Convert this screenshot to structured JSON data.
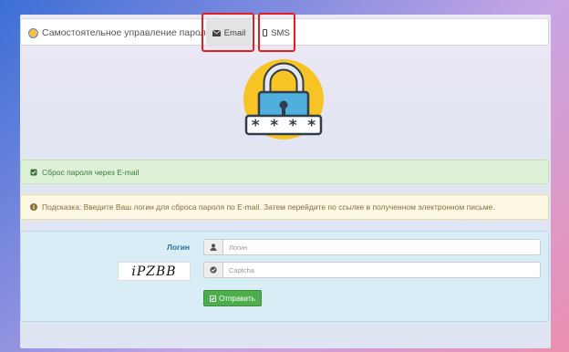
{
  "navbar": {
    "title": "Самостоятельное управление паролем",
    "tabs": [
      {
        "label": "Email",
        "icon": "envelope-icon"
      },
      {
        "label": "SMS",
        "icon": "mobile-icon"
      }
    ]
  },
  "illustration": {
    "icon": "padlock-password-icon",
    "mask": "* * * *"
  },
  "alerts": {
    "success": "Сброс пароля через E-mail",
    "info": "Подсказка: Введите Ваш логин для сброса пароля по E-mail. Затем перейдите по ссылке в полученном электронном письме."
  },
  "form": {
    "login_label": "Логин",
    "login_placeholder": "Логин",
    "captcha_image_text": "iPZBB",
    "captcha_placeholder": "Captcha",
    "submit_label": "Отправить"
  },
  "colors": {
    "highlight": "#e02020",
    "success_bg": "#dff0d8",
    "warning_bg": "#fcf8e3",
    "form_bg": "#d9edf7",
    "button": "#4cae4c"
  }
}
